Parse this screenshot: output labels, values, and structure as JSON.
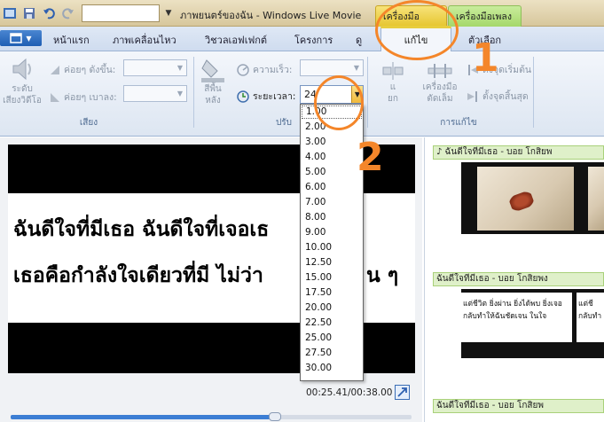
{
  "window": {
    "title": "ภาพยนตร์ของฉัน - Windows Live Movie",
    "context_tabs": [
      "เครื่องมือวิดีโอ",
      "เครื่องมือเพลง"
    ]
  },
  "ribbon_tabs": [
    "หน้าแรก",
    "ภาพเคลื่อนไหว",
    "วิชวลเอฟเฟกต์",
    "โครงการ",
    "ดู",
    "แก้ไข",
    "ตัวเลือก"
  ],
  "ribbon": {
    "audio_group": {
      "volume_label_1": "ระดับ",
      "volume_label_2": "เสียงวิดีโอ",
      "fade_in": "ค่อยๆ ดังขึ้น:",
      "fade_out": "ค่อยๆ เบาลง:",
      "group_label": "เสียง"
    },
    "adjust_group": {
      "background_label_1": "สีพื้น",
      "background_label_2": "หลัง",
      "speed": "ความเร็ว:",
      "duration": "ระยะเวลา:",
      "duration_value": "24",
      "group_label": "ปรับ"
    },
    "edit_group": {
      "split_label_1": "แ",
      "split_label_2": "ยก",
      "trim_label_1": "เครื่องมือ",
      "trim_label_2": "ตัดเล็ม",
      "set_start": "ตั้งจุดเริ่มต้น",
      "set_end": "ตั้งจุดสิ้นสุด",
      "group_label": "การแก้ไข"
    }
  },
  "duration_options": [
    "1.00",
    "2.00",
    "3.00",
    "4.00",
    "5.00",
    "6.00",
    "7.00",
    "8.00",
    "9.00",
    "10.00",
    "12.50",
    "15.00",
    "17.50",
    "20.00",
    "22.50",
    "25.00",
    "27.50",
    "30.00"
  ],
  "preview": {
    "caption_line_1": "ฉันดีใจที่มีเธอ ฉันดีใจที่เจอเธ",
    "caption_line_2": "เธอคือกำลังใจเดียวที่มี ไม่ว่า",
    "caption_line_2_tail": "น ๆ",
    "timecode": "00:25.41/00:38.00",
    "progress": 0.66
  },
  "storyboard": {
    "music_track_1": "♪ ฉันดีใจที่มีเธอ - บอย โกสิยพ",
    "caption_track_2": "ฉันดีใจที่มีเธอ - บอย โกสิยพง",
    "caption_track_3": "ฉันดีใจที่มีเธอ - บอย โกสิยพ",
    "text_frame_line_1": "แต่ชีวิต ยิ่งผ่าน ยิ่งได้พบ ยิ่งเจอ",
    "text_frame_line_2": "กลับทำให้ฉันชัดเจน ในใจ",
    "text_frame_b_line_1": "แต่ชี",
    "text_frame_b_line_2": "กลับทำ"
  },
  "annotations": [
    "1",
    "2"
  ],
  "colors": {
    "annotation": "#f4862a",
    "video_tools_tab": "#e6c52e",
    "music_tools_tab": "#a5d86a"
  }
}
